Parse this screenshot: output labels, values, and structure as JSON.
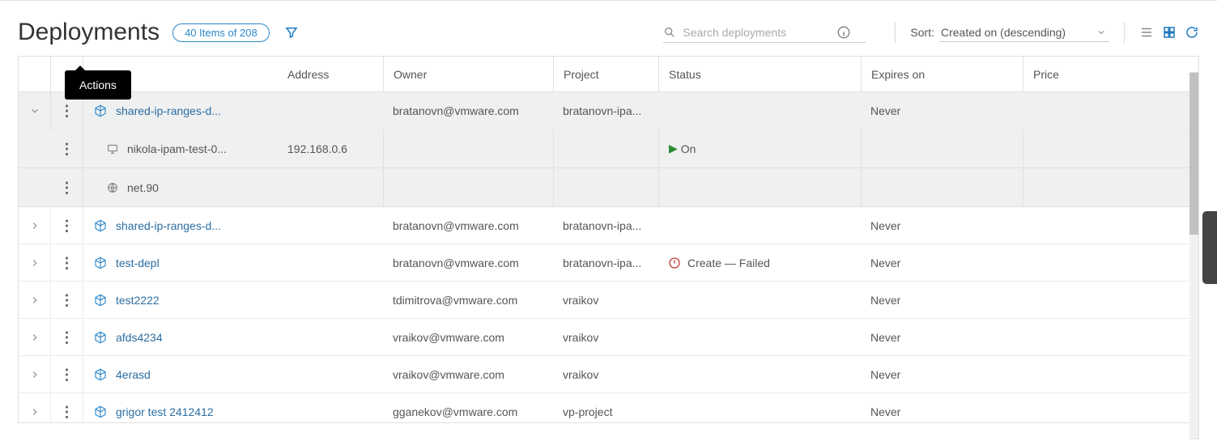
{
  "header": {
    "title": "Deployments",
    "count_label": "40 Items of 208"
  },
  "search": {
    "placeholder": "Search deployments"
  },
  "sort": {
    "label": "Sort:",
    "value": "Created on (descending)"
  },
  "tooltip": {
    "actions": "Actions"
  },
  "columns": {
    "address": "Address",
    "owner": "Owner",
    "project": "Project",
    "status": "Status",
    "expires_on": "Expires on",
    "price": "Price"
  },
  "rows": [
    {
      "expanded": true,
      "name": "shared-ip-ranges-d...",
      "address": "",
      "owner": "bratanovn@vmware.com",
      "project": "bratanovn-ipa...",
      "status": null,
      "expires": "Never",
      "price": "",
      "children": [
        {
          "type": "vm",
          "name": "nikola-ipam-test-0...",
          "address": "192.168.0.6",
          "status": "On"
        },
        {
          "type": "net",
          "name": "net.90",
          "address": "",
          "status": ""
        }
      ]
    },
    {
      "expanded": false,
      "name": "shared-ip-ranges-d...",
      "address": "",
      "owner": "bratanovn@vmware.com",
      "project": "bratanovn-ipa...",
      "status": null,
      "expires": "Never",
      "price": ""
    },
    {
      "expanded": false,
      "name": "test-depl",
      "address": "",
      "owner": "bratanovn@vmware.com",
      "project": "bratanovn-ipa...",
      "status": "Create — Failed",
      "expires": "Never",
      "price": ""
    },
    {
      "expanded": false,
      "name": "test2222",
      "address": "",
      "owner": "tdimitrova@vmware.com",
      "project": "vraikov",
      "status": null,
      "expires": "Never",
      "price": ""
    },
    {
      "expanded": false,
      "name": "afds4234",
      "address": "",
      "owner": "vraikov@vmware.com",
      "project": "vraikov",
      "status": null,
      "expires": "Never",
      "price": ""
    },
    {
      "expanded": false,
      "name": "4erasd",
      "address": "",
      "owner": "vraikov@vmware.com",
      "project": "vraikov",
      "status": null,
      "expires": "Never",
      "price": ""
    },
    {
      "expanded": false,
      "name": "grigor test 2412412",
      "address": "",
      "owner": "gganekov@vmware.com",
      "project": "vp-project",
      "status": null,
      "expires": "Never",
      "price": ""
    }
  ]
}
